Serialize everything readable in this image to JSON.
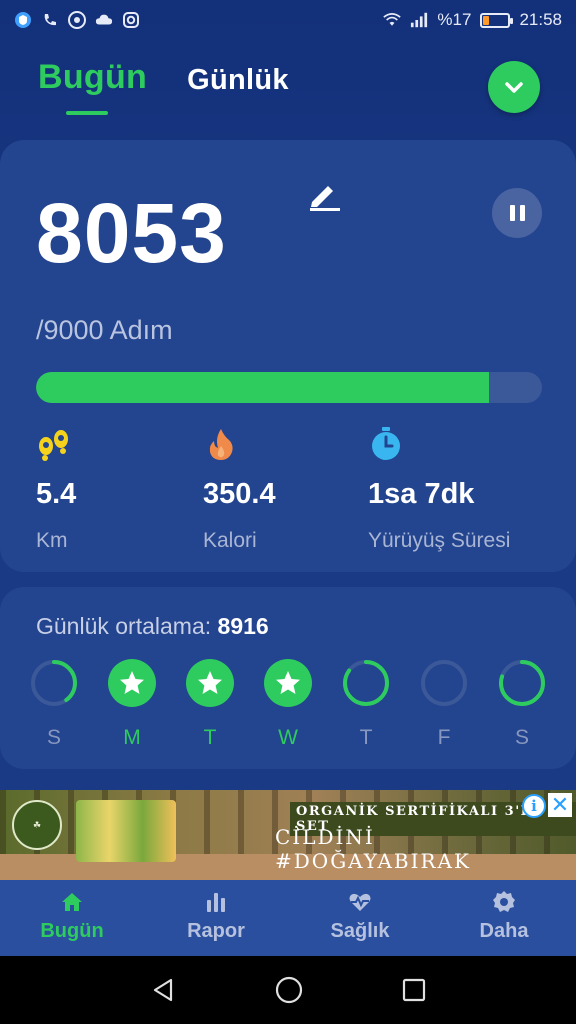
{
  "status_bar": {
    "battery_percent": "%17",
    "time": "21:58",
    "left_icons": [
      "shield-icon",
      "phone-icon",
      "chrome-icon",
      "cloud-icon",
      "instagram-icon"
    ],
    "right_icons": [
      "wifi-icon",
      "signal-icon",
      "battery-icon"
    ]
  },
  "tabs": {
    "today": "Bugün",
    "daily": "Günlük"
  },
  "main": {
    "steps": "8053",
    "goal": "/9000 Adım",
    "progress": 0.895,
    "stats": [
      {
        "value": "5.4",
        "label": "Km",
        "icon": "footprints-icon"
      },
      {
        "value": "350.4",
        "label": "Kalori",
        "icon": "flame-icon"
      },
      {
        "value": "1sa 7dk",
        "label": "Yürüyüş Süresi",
        "icon": "stopwatch-icon"
      }
    ]
  },
  "weekly": {
    "avg_label": "Günlük ortalama: ",
    "avg_value": "8916",
    "days": [
      {
        "label": "S",
        "status": "partial",
        "progress": 0.4
      },
      {
        "label": "M",
        "status": "done"
      },
      {
        "label": "T",
        "status": "done"
      },
      {
        "label": "W",
        "status": "done"
      },
      {
        "label": "T",
        "status": "partial",
        "progress": 0.85
      },
      {
        "label": "F",
        "status": "empty",
        "progress": 0
      },
      {
        "label": "S",
        "status": "partial",
        "progress": 0.8
      }
    ]
  },
  "ad": {
    "headline": "ORGANİK SERTİFİKALI 3'LÜ SET",
    "subline": "CİLDİNİ #DOĞAYABIRAK"
  },
  "bottom_nav": [
    {
      "label": "Bugün",
      "icon": "home-icon"
    },
    {
      "label": "Rapor",
      "icon": "bar-chart-icon"
    },
    {
      "label": "Sağlık",
      "icon": "heart-pulse-icon"
    },
    {
      "label": "Daha",
      "icon": "gear-icon"
    }
  ],
  "colors": {
    "accent": "#2ecb5f",
    "background": "#1a3a86",
    "card": "#23448e",
    "footprints": "#f5d31c",
    "flame": "#f08a4b",
    "stopwatch": "#39b6f0"
  }
}
